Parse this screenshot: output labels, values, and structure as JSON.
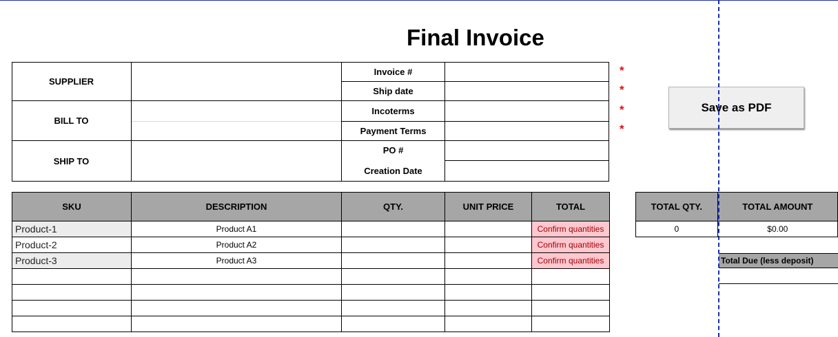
{
  "title": "Final Invoice",
  "party_labels": {
    "supplier": "SUPPLIER",
    "bill_to": "BILL TO",
    "ship_to": "SHIP TO"
  },
  "invoice_fields": [
    "Invoice #",
    "Ship date",
    "Incoterms",
    "Payment Terms",
    "PO #",
    "Creation Date"
  ],
  "required_marker": "*",
  "save_button": "Save as PDF",
  "items_table": {
    "headers": [
      "SKU",
      "DESCRIPTION",
      "QTY.",
      "UNIT PRICE",
      "TOTAL"
    ],
    "rows": [
      {
        "sku": "Product-1",
        "description": "Product A1",
        "qty": "",
        "unit_price": "",
        "total": "Confirm quantities"
      },
      {
        "sku": "Product-2",
        "description": "Product A2",
        "qty": "",
        "unit_price": "",
        "total": "Confirm quantities"
      },
      {
        "sku": "Product-3",
        "description": "Product A3",
        "qty": "",
        "unit_price": "",
        "total": "Confirm quantities"
      }
    ]
  },
  "summary": {
    "headers": [
      "TOTAL QTY.",
      "TOTAL AMOUNT"
    ],
    "total_qty": "0",
    "total_amount": "$0.00",
    "total_due_label": "Total Due (less deposit)"
  },
  "colors": {
    "header_gray": "#a6a6a6",
    "warning_fill": "#ffc7ce",
    "warning_text": "#9c0006",
    "required_red": "#e01010",
    "pagebreak_blue": "#1a2bb0"
  }
}
